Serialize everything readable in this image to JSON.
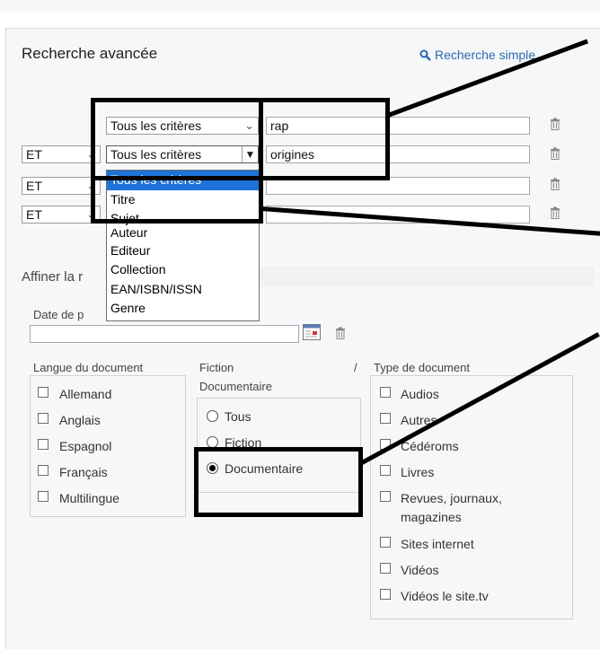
{
  "header": {
    "title": "Recherche avancée",
    "simple_search": "Recherche simple"
  },
  "rows": [
    {
      "operator": "",
      "criteria": "Tous les critères",
      "value": "rap"
    },
    {
      "operator": "ET",
      "criteria": "Tous les critères",
      "value": "origines"
    },
    {
      "operator": "ET",
      "criteria": "",
      "value": ""
    },
    {
      "operator": "ET",
      "criteria": "",
      "value": ""
    }
  ],
  "dropdown": {
    "options": [
      "Tous les critères",
      "Titre",
      "Sujet",
      "Auteur",
      "Editeur",
      "Collection",
      "EAN/ISBN/ISSN",
      "Genre"
    ],
    "selected": "Tous les critères"
  },
  "refine": {
    "title": "Affiner la r",
    "date_label": "Date de p",
    "date_value": ""
  },
  "langue": {
    "label": "Langue du document",
    "items": [
      "Allemand",
      "Anglais",
      "Espagnol",
      "Français",
      "Multilingue"
    ]
  },
  "fiction": {
    "label_1": "Fiction",
    "separator": "/",
    "label_2": "Documentaire",
    "options": [
      "Tous",
      "Fiction",
      "Documentaire"
    ],
    "selected": "Documentaire"
  },
  "type": {
    "label": "Type de document",
    "items": [
      "Audios",
      "Autres",
      "Cédéroms",
      "Livres",
      "Revues, journaux,",
      "magazines",
      "Sites internet",
      "Vidéos",
      "Vidéos le site.tv"
    ]
  },
  "colors": {
    "accent": "#2a6bb0",
    "highlight": "#1e73d8",
    "annotation": "#000000"
  }
}
